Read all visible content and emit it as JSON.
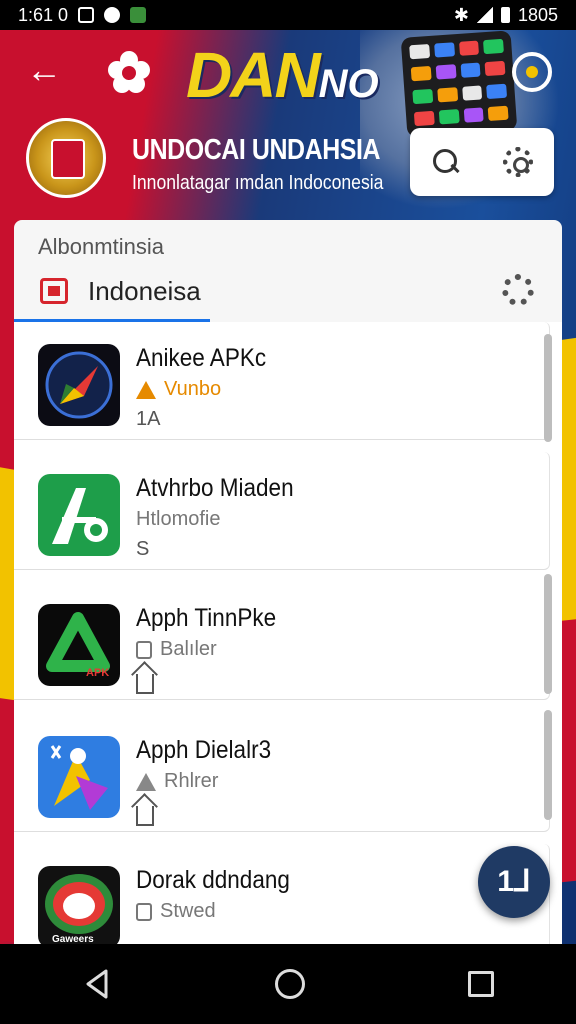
{
  "status_bar": {
    "time": "1:61 0",
    "clock_right": "1805"
  },
  "header": {
    "brand_main": "DAN",
    "brand_suffix": "NO",
    "title": "UNDOCAI UNDAHSIA",
    "subtitle": "Innonlatagar ımdan Indoconesia"
  },
  "search_card": {
    "label": "Albonmtinsia",
    "value": "Indoneisa"
  },
  "apps": [
    {
      "name": "Anikee APKc",
      "meta": "Vunbo",
      "extra": "1A",
      "meta_style": "orange"
    },
    {
      "name": "Atvhrbo Miaden",
      "meta": "Htlomofie",
      "extra": "S",
      "meta_style": "grey"
    },
    {
      "name": "Apph TinnPke",
      "meta": "Balıler",
      "extra": "",
      "meta_style": "grey"
    },
    {
      "name": "Apph Dielalr3",
      "meta": "Rhlrer",
      "extra": "",
      "meta_style": "grey"
    },
    {
      "name": "Dorak ddndang",
      "meta": "Stwed",
      "extra": "",
      "meta_style": "grey"
    }
  ],
  "app_icon_texts": {
    "apk_badge": "APK",
    "gamer_badge": "Gaweers"
  },
  "fab_label": "1⅃",
  "colors": {
    "accent": "#1a73e8",
    "fab": "#1f3a64",
    "brand_yellow": "#f3d31a",
    "flag_red": "#c8102e"
  },
  "icons": [
    "back-arrow-icon",
    "flower-icon",
    "target-icon",
    "search-icon",
    "gear-icon",
    "pdf-icon",
    "nav-back-icon",
    "nav-home-icon",
    "nav-recents-icon"
  ]
}
